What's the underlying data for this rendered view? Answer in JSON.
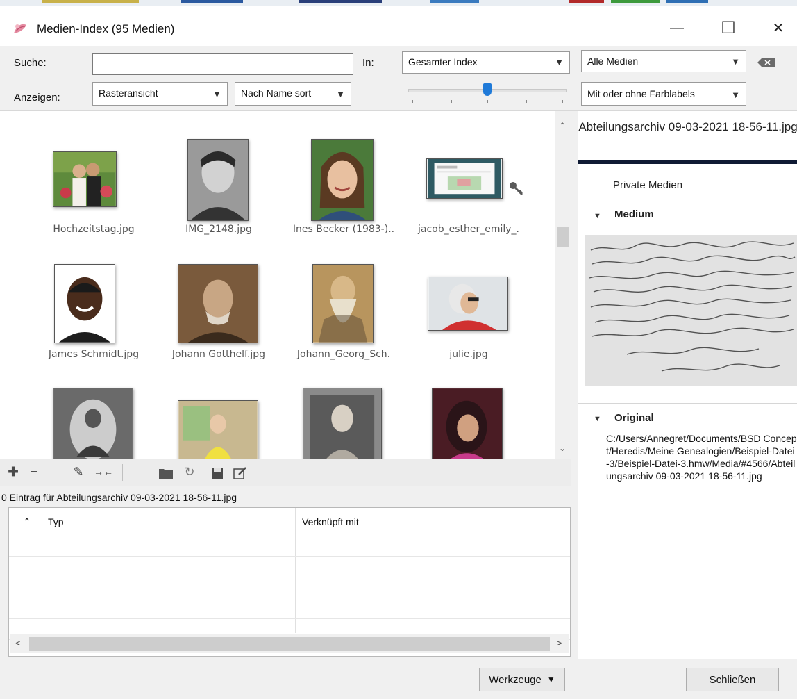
{
  "window": {
    "title": "Medien-Index (95 Medien)",
    "minimize_glyph": "—",
    "maximize_glyph": "☐",
    "close_glyph": "✕"
  },
  "toolbar": {
    "search_label": "Suche:",
    "search_value": "",
    "in_label": "In:",
    "scope_value": "Gesamter Index",
    "media_filter_value": "Alle Medien",
    "show_label": "Anzeigen:",
    "view_value": "Rasteransicht",
    "sort_value": "Nach Name sort",
    "color_label_filter_value": "Mit oder ohne Farblabels",
    "thumbnail_size_level": 0.5
  },
  "grid": {
    "items": [
      {
        "name": "Hochzeitstag.jpg"
      },
      {
        "name": "IMG_2148.jpg"
      },
      {
        "name": "Ines Becker (1983-).."
      },
      {
        "name": "jacob_esther_emily_."
      },
      {
        "name": "James Schmidt.jpg"
      },
      {
        "name": "Johann Gotthelf.jpg"
      },
      {
        "name": "Johann_Georg_Sch."
      },
      {
        "name": "julie.jpg"
      },
      {
        "name": ""
      },
      {
        "name": ""
      },
      {
        "name": ""
      },
      {
        "name": ""
      }
    ]
  },
  "actions": {
    "icons": [
      "plus-icon",
      "minus-icon",
      "pencil-icon",
      "merge-icon",
      "folder-icon",
      "refresh-icon",
      "save-icon",
      "edit-icon"
    ]
  },
  "entries": {
    "label": "0 Eintrag für Abteilungsarchiv 09-03-2021 18-56-11.jpg",
    "columns": [
      "Typ",
      "Verknüpft mit"
    ]
  },
  "side": {
    "title": "Abteilungsarchiv 09-03-2021 18-56-11.jpg",
    "private_label": "Private Medien",
    "medium_label": "Medium",
    "original_label": "Original",
    "original_path": "C:/Users/Annegret/Documents/BSD Concept/Heredis/Meine Genealogien/Beispiel-Datei-3/Beispiel-Datei-3.hmw/Media/#4566/Abteilungsarchiv 09-03-2021 18-56-11.jpg"
  },
  "bottom": {
    "tools_label": "Werkzeuge",
    "close_label": "Schließen"
  }
}
